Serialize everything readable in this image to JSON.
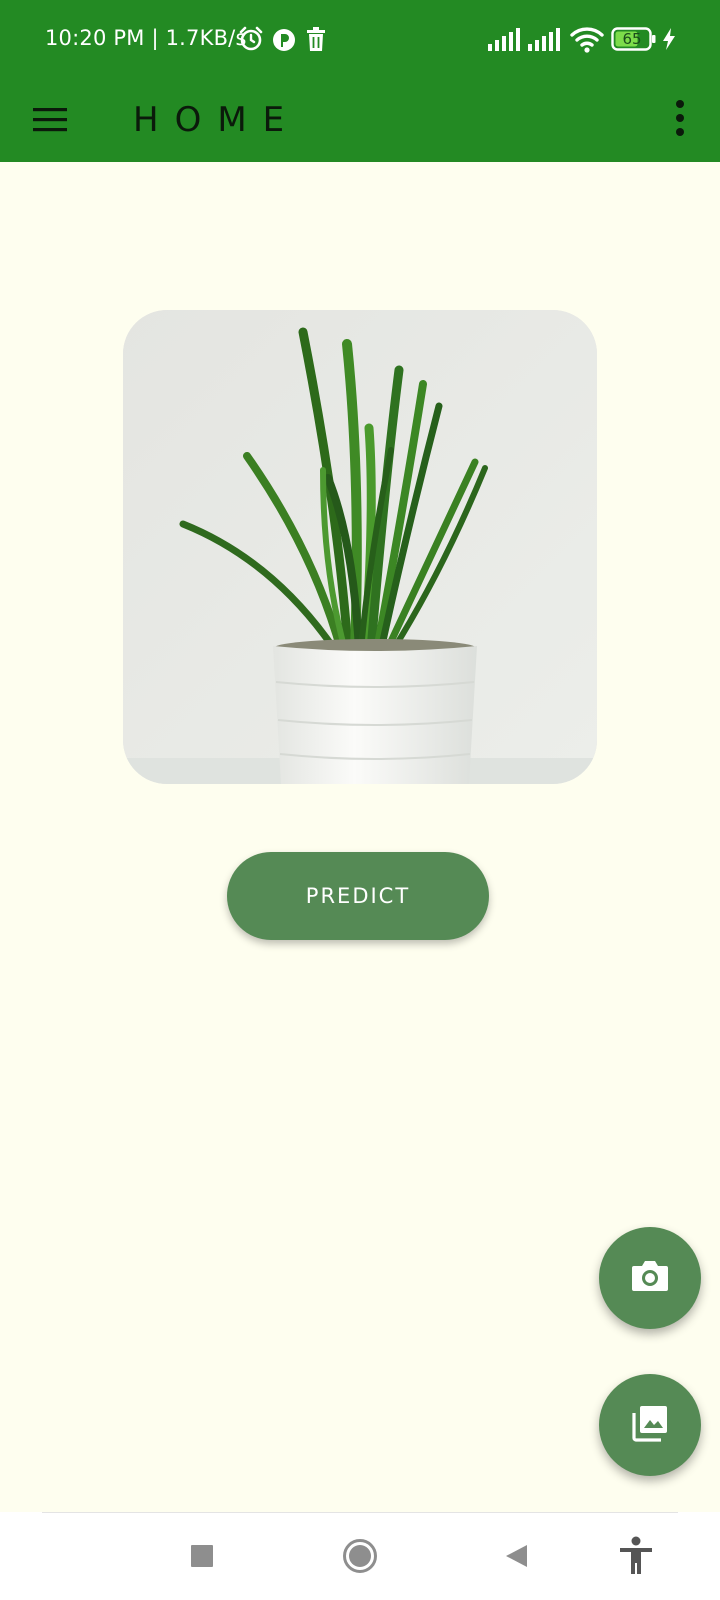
{
  "status_bar": {
    "time_speed": "10:20 PM | 1.7KB/s",
    "battery": "65",
    "icons": [
      "alarm-icon",
      "app-notification-icon",
      "trash-icon",
      "signal-icon",
      "signal-icon",
      "wifi-icon",
      "battery-icon",
      "charging-icon"
    ]
  },
  "app_bar": {
    "title": "HOME",
    "menu_icon": "hamburger-menu-icon",
    "overflow_icon": "more-vert-icon"
  },
  "main": {
    "image_subject": "potted-snake-plant",
    "predict_label": "PREDICT"
  },
  "fabs": {
    "camera_icon": "camera-icon",
    "gallery_icon": "gallery-icon"
  },
  "nav_bar": {
    "icons": [
      "recents-square-icon",
      "home-circle-icon",
      "back-triangle-icon",
      "accessibility-icon"
    ]
  },
  "colors": {
    "app_bar": "#238a23",
    "background": "#fefeef",
    "button": "#558a55"
  }
}
